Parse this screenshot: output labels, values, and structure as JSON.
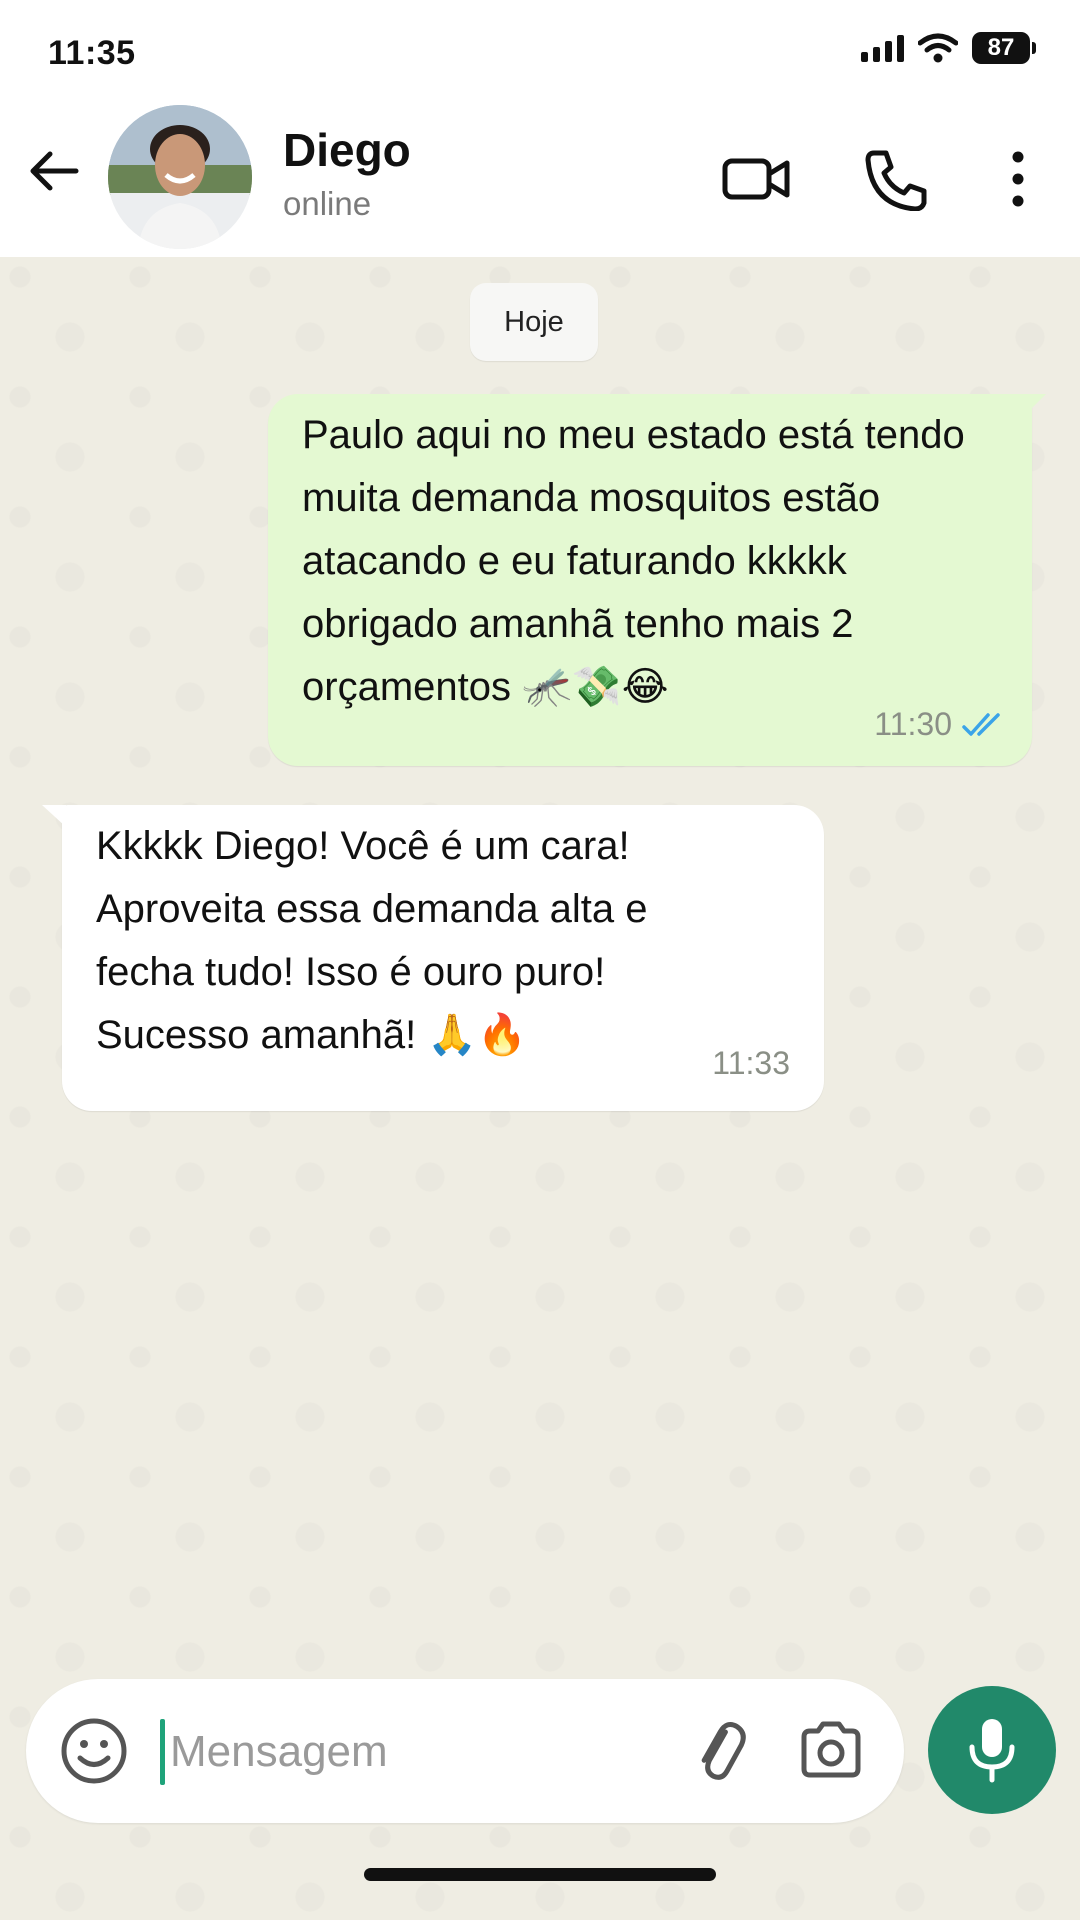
{
  "status_bar": {
    "time": "11:35",
    "battery": "87"
  },
  "header": {
    "contact_name": "Diego",
    "contact_status": "online",
    "icons": [
      "back-arrow-icon",
      "video-call-icon",
      "phone-icon",
      "more-vertical-icon"
    ]
  },
  "chat": {
    "date_chip": "Hoje",
    "messages": [
      {
        "direction": "outgoing",
        "text": "Paulo aqui no meu estado está tendo muita demanda mosquitos estão atacando e eu faturando kkkkk obrigado amanhã tenho mais 2 orçamentos 🦟💸😂",
        "time": "11:30",
        "status": "read"
      },
      {
        "direction": "incoming",
        "text": "Kkkkk Diego! Você é um cara! Aproveita essa demanda alta e fecha tudo! Isso é ouro puro! Sucesso amanhã! 🙏🔥",
        "time": "11:33"
      }
    ]
  },
  "input": {
    "placeholder": "Mensagem",
    "icons": [
      "emoji-icon",
      "attach-icon",
      "camera-icon",
      "microphone-icon"
    ]
  },
  "colors": {
    "accent": "#21896a",
    "outgoing_bubble": "#e4f9d2",
    "incoming_bubble": "#ffffff",
    "chat_background": "#efede3",
    "read_ticks": "#3ba4e8"
  }
}
